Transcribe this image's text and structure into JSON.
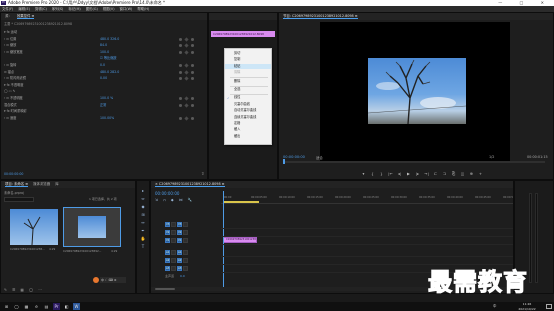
{
  "window": {
    "app_logo": "Pr",
    "title": "Adobe Premiere Pro 2020 - C:\\用户\\Ddyy\\文档\\Adobe\\Premiere Pro\\14.0\\未命名 *",
    "controls": [
      "—",
      "□",
      "✕"
    ]
  },
  "menubar": [
    "文件(F)",
    "编辑(E)",
    "剪辑(C)",
    "序列(S)",
    "标记(M)",
    "图形(G)",
    "视图(V)",
    "窗口(W)",
    "帮助(H)"
  ],
  "effect_controls": {
    "tabs": [
      "源：",
      "效果控件 ≡"
    ],
    "clip_path": "主要 * C20697989231001238921012.8098",
    "sequence_path": "C20697989231001238921012.8098 * C20697989231001238921012.8098",
    "rows": [
      {
        "label": "▾ fx 运动",
        "value": ""
      },
      {
        "label": "› ⊙ 位置",
        "value": "480.0   326.0"
      },
      {
        "label": "› ⊙ 缩放",
        "value": "84.0"
      },
      {
        "label": "› ⊙ 缩放宽度",
        "value": "100.0"
      },
      {
        "label": "",
        "value": "☑ 等比缩放"
      },
      {
        "label": "› ⊙ 旋转",
        "value": "0.0"
      },
      {
        "label": "  ⊙ 锚点",
        "value": "480.0   282.0"
      },
      {
        "label": "› ⊙ 防闪烁滤镜",
        "value": "0.00"
      },
      {
        "label": "▾ fx 不透明度",
        "value": ""
      },
      {
        "label": "  ◯ ▭ ✎",
        "value": ""
      },
      {
        "label": "› ⊙ 不透明度",
        "value": "100.0 %"
      },
      {
        "label": "  混合模式",
        "value": "正常"
      },
      {
        "label": "▾ fx 时间重映射",
        "value": ""
      },
      {
        "label": "› ⊙ 速度",
        "value": "100.00%"
      }
    ],
    "timecode": "00:00:00:00"
  },
  "mini_timeline_clip": "C20697989231001238921012.8098",
  "context_menu": {
    "items": [
      {
        "label": "剪切",
        "state": "normal"
      },
      {
        "label": "复制",
        "state": "normal"
      },
      {
        "label": "粘贴",
        "state": "highlight"
      },
      {
        "label": "清除",
        "state": "disabled"
      },
      {
        "label": "删除",
        "state": "normal"
      },
      {
        "label": "全选",
        "state": "normal"
      },
      {
        "label": "线性",
        "state": "checked"
      },
      {
        "label": "贝塞尔曲线",
        "state": "normal"
      },
      {
        "label": "自动贝塞尔曲线",
        "state": "normal"
      },
      {
        "label": "连续贝塞尔曲线",
        "state": "normal"
      },
      {
        "label": "定格",
        "state": "normal"
      },
      {
        "label": "缓入",
        "state": "normal"
      },
      {
        "label": "缓出",
        "state": "normal"
      }
    ]
  },
  "program_monitor": {
    "title": "节目: C20697989231001238921012.8098 ≡",
    "timecode_left": "00:00:00:00",
    "fit": "适合",
    "quality": "1/2",
    "timecode_right": "00:00:01:15",
    "controls": [
      "▾",
      "{",
      "}",
      "|←",
      "◂|",
      "▶",
      "|▸",
      "→|",
      "⊏",
      "⊐",
      "⎘",
      "◫",
      "⊕",
      "+"
    ]
  },
  "project_panel": {
    "tabs": [
      "项目: 未命名 ≡",
      "媒体浏览器",
      "库"
    ],
    "project_file": "未命名.prproj",
    "item_count": "1 项已选择，共 2 项",
    "items": [
      {
        "name": "C20697989231001238...",
        "duration": "4:29"
      },
      {
        "name": "C2069798923100123892...",
        "duration": "4:29"
      }
    ]
  },
  "tools": [
    "▸",
    "⇔",
    "◆",
    "⊞",
    "↔",
    "✒",
    "✋",
    "T"
  ],
  "timeline": {
    "tab": "× C20697989231001238921012.8098 ≡",
    "timecode": "00:00:00:00",
    "ruler_labels": [
      ":00:00",
      "00:00:05:00",
      "00:00:10:00",
      "00:00:15:00",
      "00:00:20:00",
      "00:00:25:00",
      "00:00:30:00",
      "00:00:35:00",
      "00:00:40:00",
      "00:00:45:00",
      "00:00:5"
    ],
    "video_tracks": [
      "V3",
      "V2",
      "V1"
    ],
    "audio_tracks": [
      "A1",
      "A2",
      "A3"
    ],
    "master": "主声道",
    "master_value": "0.0",
    "clip_label": "C20697989231001238921012.8098"
  },
  "taskbar": {
    "icons": [
      "⊞",
      "◯",
      "▦",
      "e",
      "▤",
      "Pr",
      "◧",
      "W"
    ],
    "time": "11:26",
    "date": "2021/10/22",
    "ime": "中"
  },
  "watermark": "最需教育",
  "colors": {
    "accent": "#4e9be6",
    "clip_pink": "#d98bf0",
    "panel": "#1e1e1e",
    "menu_highlight": "#cde6f7"
  }
}
